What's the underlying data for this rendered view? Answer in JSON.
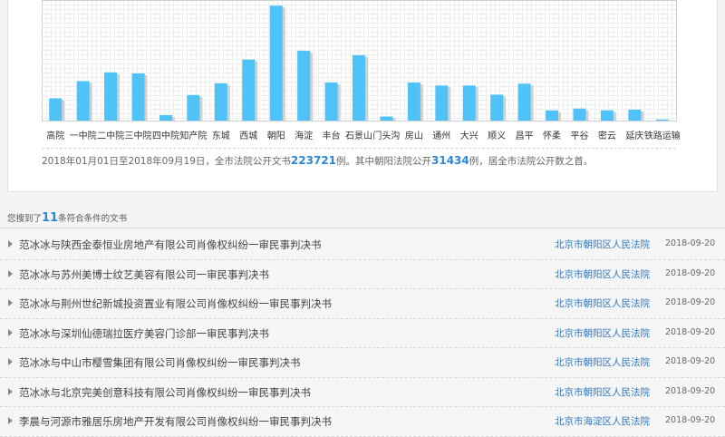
{
  "chart_data": {
    "type": "bar",
    "categories": [
      "高院",
      "一中院",
      "二中院",
      "三中院",
      "四中院",
      "知产院",
      "东城",
      "西城",
      "朝阳",
      "海淀",
      "丰台",
      "石景山",
      "门头沟",
      "房山",
      "通州",
      "大兴",
      "顺义",
      "昌平",
      "怀柔",
      "平谷",
      "密云",
      "延庆",
      "铁路运输"
    ],
    "values": [
      6100,
      10800,
      13200,
      12900,
      1500,
      7000,
      10200,
      16700,
      31434,
      19100,
      10400,
      17900,
      1100,
      10400,
      9600,
      9600,
      7100,
      10100,
      2800,
      3300,
      2800,
      3000,
      300
    ],
    "ylim": [
      0,
      32500
    ],
    "bar_color": "#4fc3f7",
    "shadow_color": "#d0d0d0",
    "grid": true
  },
  "summary": {
    "part1": "2018年01月01日至2018年09月19日，全市法院公开文书",
    "total": "223721",
    "part2": "例。其中朝阳法院公开",
    "chaoyang": "31434",
    "part3": "例，居全市法院公开数之首。"
  },
  "results": {
    "prefix": "您搜到了",
    "count": "11",
    "suffix": "条符合条件的文书"
  },
  "rows": [
    {
      "title": "范冰冰与陕西金泰恒业房地产有限公司肖像权纠纷一审民事判决书",
      "court": "北京市朝阳区人民法院",
      "date": "2018-09-20"
    },
    {
      "title": "范冰冰与苏州美博士纹艺美容有限公司一审民事判决书",
      "court": "北京市朝阳区人民法院",
      "date": "2018-09-20"
    },
    {
      "title": "范冰冰与荆州世纪新城投资置业有限公司肖像权纠纷一审民事判决书",
      "court": "北京市朝阳区人民法院",
      "date": "2018-09-20"
    },
    {
      "title": "范冰冰与深圳仙德瑞拉医疗美容门诊部一审民事判决书",
      "court": "北京市朝阳区人民法院",
      "date": "2018-09-20"
    },
    {
      "title": "范冰冰与中山市樱雪集团有限公司肖像权纠纷一审民事判决书",
      "court": "北京市朝阳区人民法院",
      "date": "2018-09-20"
    },
    {
      "title": "范冰冰与北京完美创意科技有限公司肖像权纠纷一审民事判决书",
      "court": "北京市朝阳区人民法院",
      "date": "2018-09-20"
    },
    {
      "title": "李晨与河源市雅居乐房地产开发有限公司肖像权纠纷一审民事判决书",
      "court": "北京市海淀区人民法院",
      "date": "2018-09-20"
    }
  ]
}
